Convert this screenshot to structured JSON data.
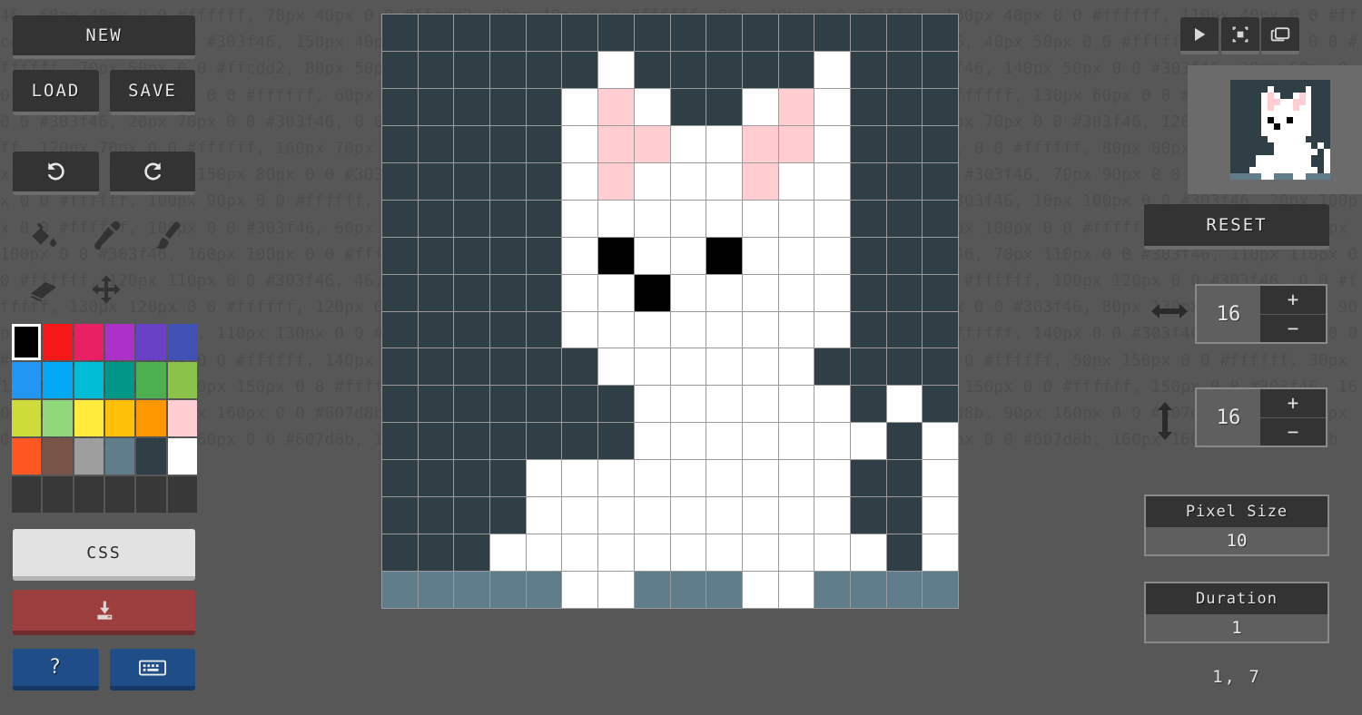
{
  "background_code": "46, 60px 40px 0 0 #ffffff, 70px 40px 0 0 #ffcdd2, 80px 40px 0 0 #ffffff, 90px 40px 0 0 #ffffff, 100px 40px 0 0 #ffffff, 110px 40px 0 0 #ffcdd2, 130px 40px 0 0 #303f46, 150px 40px 0 0 #303f46, 20px 50px 0 0 #303f46, 30px 50px 0 0 #303f46, 40px 50px 0 0 #ffffff, 60px 50px 0 0 #ffffff, 70px 50px 0 0 #ffcdd2, 80px 50px 0 0 #ffcdd2, 110px 50px 0 0 #ffcdd2, 120px 50px 0 0 #303f46, 140px 50px 0 0 #303f46, 20px 60px 0 0 #303f46, 40px 60px 0 0 #ffffff, 60px 60px 0 0 #ffffff, 100px 60px 0 0 #ffffff, 120px 60px 0 0 #ffffff, 130px 60px 0 0 #ffffff, 10px 70px 0 0 #303f46, 20px 70px 0 0 #303f46, 0 0 #303f46, 50px 70px 0 0 #303f46, 90px 70px 0 0 #000000, 90px 70px 0 0 #303f46, 120px 70px 0 0 #ffffff, 120px 70px 0 0 #ffffff, 160px 70px 0 0 #303f46, 40px 80px 0 0 #303f46, 110px 80px 0 0 #ffffff, 0 0 #ffffff, 80px 80px 0 0 #ffffff, 90px 80px 0 0 #303f46, 150px 80px 0 0 #303f46, 46, 20px 90px 0 0 #303f46, 30px 90px 0 0 #ffffff, 0 0 #303f46, 70px 90px 0 0 #303f46, 90px 90px 0 0 #ffffff, 100px 90px 0 0 #ffffff, 140px 90px 0 0 #303f46, 150px 90px 0 0 #303f46, 90px 0 0 #303f46, 10px 100px 0 0 #303f46, 20px 100px 0 0 #ffffff, 100px 0 0 #303f46, 60px 100px 0 0 #303f46, 0 0 #303f46, 80px 100px 0 0 #ffffff, 90px 100px 0 0 #ffffff, 0 0 #303f46, 130px 100px 0 0 #303f46, 160px 100px 0 0 #ffffff, 46, 160px 100px 0 0 #303f46, 40px 110px 0 0 #303f46, 46, 70px 110px 0 0 #303f46, 110px 110px 0 0 #ffffff, 120px 110px 0 0 #303f46, 46, 110px 0 0 #303f46, 20px 120px 0 0 #303f46, 30px 120px 0 0 #ffffff, 100px 120px 0 0 #303f46, 0 0 #ffffff, 130px 120px 0 0 #ffffff, 120px 0 0 #303f46, 10px 120px 0 0 #ffffff, 0 0 #ffffff, 40px 130px 0 0 #303f46, 80px 130px 0 0 #ffffff, 90px 130px 0 0 #ffffff, 110px 130px 0 0 #ffffff, 303f46, 150px 130px 0 0 #ffffff, 160px 130px 0 0 #ffffff, 140px 0 0 #303f46, 20px 140px 0 0 #303f46, 60px 140px 0 0 #ffffff, 140px 0 0 #ffffff, 140px 0 0 #303f46, 140px 0 0 #ffffff, 100px 0 0 #ffffff, 50px 150px 0 0 #ffffff, 30px 150px 0 0 #303f46, 10px 150px 0 0 #ffffff, 120px 150px 0 0 #ffffff, 130px 150px 0 0 #ffffff, 80px 150px 0 0 #ffffff, 150px 0 0 #303f46, 160px 0 0 #607d8b, 60px 160px 0 0 #607d8b, 0 0 #ffffff, 70px 160px 0 0 #ffffff, 80px 160px 0 0 #607d8b, 90px 160px 0 0 #607d8b, 100px 160px 0 0 #607d8b, 110px 160px 0 0 #607d8b, 130px 160px 0 0 #607d8b, 140px 160px 0 0 #607d8b, 150px 160px 0 0 #607d8b, 160px 160px 0 0 #607d8b",
  "left_panel": {
    "new_label": "NEW",
    "load_label": "LOAD",
    "save_label": "SAVE",
    "undo_label": "↺",
    "redo_label": "↻",
    "css_label": "CSS",
    "tools": [
      {
        "name": "paint-bucket-tool",
        "label": "fill"
      },
      {
        "name": "eyedropper-tool",
        "label": "pick"
      },
      {
        "name": "brush-tool",
        "label": "brush"
      },
      {
        "name": "eraser-tool",
        "label": "eraser"
      },
      {
        "name": "move-tool",
        "label": "move"
      }
    ],
    "help_label": "?",
    "palette": {
      "selected_index": 0,
      "colors": [
        "#000000",
        "#f71818",
        "#e92063",
        "#ab31c9",
        "#6941c6",
        "#3f51b5",
        "#2196f3",
        "#03a9f4",
        "#00bcd4",
        "#009688",
        "#4caf50",
        "#8bc34a",
        "#cddc39",
        "#8fd97a",
        "#ffeb3b",
        "#ffc107",
        "#ff9800",
        "#ffcdd2",
        "#ff5722",
        "#795548",
        "#9e9e9e",
        "#607d8b",
        "#303f46",
        "#ffffff",
        "",
        "",
        "",
        "",
        "",
        ""
      ]
    }
  },
  "right_panel": {
    "top_icons": [
      {
        "name": "play-icon",
        "label": "play"
      },
      {
        "name": "sprite-icon",
        "label": "sprite"
      },
      {
        "name": "frames-icon",
        "label": "frames"
      }
    ],
    "reset_label": "RESET",
    "width": {
      "value": "16",
      "plus": "+",
      "minus": "−"
    },
    "height": {
      "value": "16",
      "plus": "+",
      "minus": "−"
    },
    "pixel_size": {
      "label": "Pixel Size",
      "value": "10"
    },
    "duration": {
      "label": "Duration",
      "value": "1"
    },
    "coordinates": "1, 7"
  },
  "canvas": {
    "cols": 16,
    "rows": 16,
    "grid_line_color": "#9a9a9a",
    "palette": {
      "d": "#303f46",
      "w": "#ffffff",
      "p": "#ffcdd2",
      "k": "#000000",
      "b": "#607d8b"
    },
    "pixels": [
      "dddddddddddddddd",
      "ddddddwdddddwddd",
      "dddddwpwddwpwddd",
      "dddddwppwwppwddd",
      "dddddwpwwwpwwddd",
      "dddddwwwwwwwwddd",
      "dddddwkwwkwwwddd",
      "dddddwwkwwwwwddd",
      "dddddwwwwwwwwddd",
      "ddddddwwwwwwdddd",
      "dddddddwwwwwwdwd",
      "dddddddwwwwwwwdw",
      "ddddwwwwwwwwwddw",
      "ddddwwwwwwwwwddw",
      "dddwwwwwwwwwwwdw",
      "bbbbbwwbbbwwbbbb"
    ]
  }
}
